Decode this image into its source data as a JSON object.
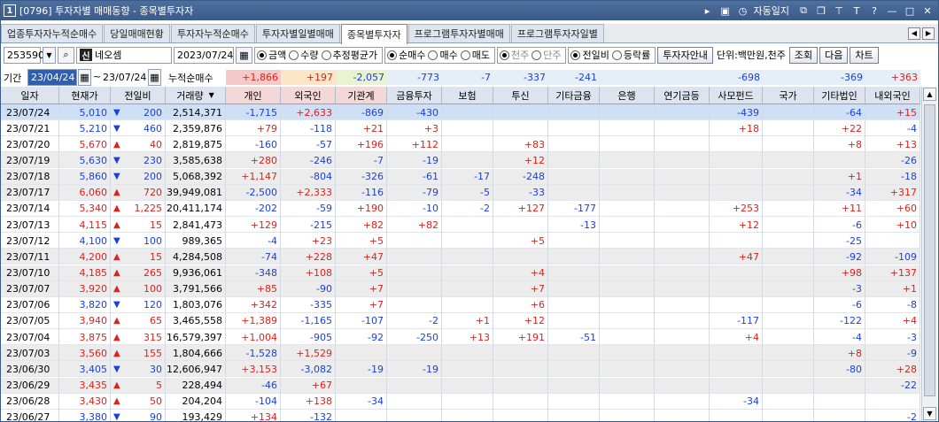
{
  "titlebar": {
    "num": "1",
    "code": "[0796]",
    "title": "투자자별 매매동향 - 종목별투자자",
    "auto_label": "자동일지",
    "help": "?"
  },
  "tabs": [
    "업종투자자누적순매수",
    "당일매매현황",
    "투자자누적순매수",
    "투자자별일별매매",
    "종목별투자자",
    "프로그램투자자별매매",
    "프로그램투자자일별"
  ],
  "active_tab": 4,
  "toolbar": {
    "code": "253590",
    "sin": "신",
    "name": "네오셈",
    "date": "2023/07/24",
    "g1": [
      {
        "label": "금액",
        "on": true
      },
      {
        "label": "수량",
        "on": false
      },
      {
        "label": "추정평균가",
        "on": false
      }
    ],
    "g2": [
      {
        "label": "순매수",
        "on": true
      },
      {
        "label": "매수",
        "on": false
      },
      {
        "label": "매도",
        "on": false
      }
    ],
    "g3": [
      {
        "label": "천주",
        "on": true
      },
      {
        "label": "단주",
        "on": false
      }
    ],
    "g4": [
      {
        "label": "전일비",
        "on": true
      },
      {
        "label": "등락률",
        "on": false
      }
    ],
    "investor_btn": "투자자안내",
    "unit": "단위:백만원,천주",
    "query": "조회",
    "next": "다음",
    "chart": "차트"
  },
  "period": {
    "label": "기간",
    "from": "23/04/24",
    "to": "23/07/24",
    "cum_label": "누적순매수",
    "sums": [
      "+1,866",
      "+197",
      "-2,057",
      "-773",
      "-7",
      "-337",
      "-241",
      "",
      "",
      "-698",
      "",
      "-369",
      "+363"
    ]
  },
  "headers": [
    "일자",
    "현재가",
    "전일비",
    "거래량",
    "개인",
    "외국인",
    "기관계",
    "금융투자",
    "보험",
    "투신",
    "기타금융",
    "은행",
    "연기금등",
    "사모펀드",
    "국가",
    "기타법인",
    "내외국인"
  ],
  "rows": [
    {
      "d": "23/07/24",
      "p": "5,010",
      "dir": "dn",
      "c": "200",
      "v": "2,514,371",
      "vals": [
        "-1,715",
        "+2,633",
        "-869",
        "-430",
        "",
        "",
        "",
        "",
        "",
        "-439",
        "",
        "-64",
        "+15"
      ]
    },
    {
      "d": "23/07/21",
      "p": "5,210",
      "dir": "dn",
      "c": "460",
      "v": "2,359,876",
      "vals": [
        "+79",
        "-118",
        "+21",
        "+3",
        "",
        "",
        "",
        "",
        "",
        "+18",
        "",
        "+22",
        "-4"
      ]
    },
    {
      "d": "23/07/20",
      "p": "5,670",
      "dir": "up",
      "c": "40",
      "v": "2,819,875",
      "vals": [
        "-160",
        "-57",
        "+196",
        "+112",
        "",
        "+83",
        "",
        "",
        "",
        "",
        "",
        "+8",
        "+13"
      ]
    },
    {
      "d": "23/07/19",
      "p": "5,630",
      "dir": "dn",
      "c": "230",
      "v": "3,585,638",
      "vals": [
        "+280",
        "-246",
        "-7",
        "-19",
        "",
        "+12",
        "",
        "",
        "",
        "",
        "",
        "",
        "-26"
      ]
    },
    {
      "d": "23/07/18",
      "p": "5,860",
      "dir": "dn",
      "c": "200",
      "v": "5,068,392",
      "vals": [
        "+1,147",
        "-804",
        "-326",
        "-61",
        "-17",
        "-248",
        "",
        "",
        "",
        "",
        "",
        "+1",
        "-18"
      ]
    },
    {
      "d": "23/07/17",
      "p": "6,060",
      "dir": "up",
      "c": "720",
      "v": "39,949,081",
      "vals": [
        "-2,500",
        "+2,333",
        "-116",
        "-79",
        "-5",
        "-33",
        "",
        "",
        "",
        "",
        "",
        "-34",
        "+317"
      ]
    },
    {
      "d": "23/07/14",
      "p": "5,340",
      "dir": "up",
      "c": "1,225",
      "v": "20,411,174",
      "vals": [
        "-202",
        "-59",
        "+190",
        "-10",
        "-2",
        "+127",
        "-177",
        "",
        "",
        "+253",
        "",
        "+11",
        "+60"
      ]
    },
    {
      "d": "23/07/13",
      "p": "4,115",
      "dir": "up",
      "c": "15",
      "v": "2,841,473",
      "vals": [
        "+129",
        "-215",
        "+82",
        "+82",
        "",
        "",
        "-13",
        "",
        "",
        "+12",
        "",
        "-6",
        "+10"
      ]
    },
    {
      "d": "23/07/12",
      "p": "4,100",
      "dir": "dn",
      "c": "100",
      "v": "989,365",
      "vals": [
        "-4",
        "+23",
        "+5",
        "",
        "",
        "+5",
        "",
        "",
        "",
        "",
        "",
        "-25",
        ""
      ]
    },
    {
      "d": "23/07/11",
      "p": "4,200",
      "dir": "up",
      "c": "15",
      "v": "4,284,508",
      "vals": [
        "-74",
        "+228",
        "+47",
        "",
        "",
        "",
        "",
        "",
        "",
        "+47",
        "",
        "-92",
        "-109"
      ]
    },
    {
      "d": "23/07/10",
      "p": "4,185",
      "dir": "up",
      "c": "265",
      "v": "9,936,061",
      "vals": [
        "-348",
        "+108",
        "+5",
        "",
        "",
        "+4",
        "",
        "",
        "",
        "",
        "",
        "+98",
        "+137"
      ]
    },
    {
      "d": "23/07/07",
      "p": "3,920",
      "dir": "up",
      "c": "100",
      "v": "3,791,566",
      "vals": [
        "+85",
        "-90",
        "+7",
        "",
        "",
        "+7",
        "",
        "",
        "",
        "",
        "",
        "-3",
        "+1"
      ]
    },
    {
      "d": "23/07/06",
      "p": "3,820",
      "dir": "dn",
      "c": "120",
      "v": "1,803,076",
      "vals": [
        "+342",
        "-335",
        "+7",
        "",
        "",
        "+6",
        "",
        "",
        "",
        "",
        "",
        "-6",
        "-8"
      ]
    },
    {
      "d": "23/07/05",
      "p": "3,940",
      "dir": "up",
      "c": "65",
      "v": "3,465,558",
      "vals": [
        "+1,389",
        "-1,165",
        "-107",
        "-2",
        "+1",
        "+12",
        "",
        "",
        "",
        "-117",
        "",
        "-122",
        "+4"
      ]
    },
    {
      "d": "23/07/04",
      "p": "3,875",
      "dir": "up",
      "c": "315",
      "v": "16,579,397",
      "vals": [
        "+1,004",
        "-905",
        "-92",
        "-250",
        "+13",
        "+191",
        "-51",
        "",
        "",
        "+4",
        "",
        "-4",
        "-3"
      ]
    },
    {
      "d": "23/07/03",
      "p": "3,560",
      "dir": "up",
      "c": "155",
      "v": "1,804,666",
      "vals": [
        "-1,528",
        "+1,529",
        "",
        "",
        "",
        "",
        "",
        "",
        "",
        "",
        "",
        "+8",
        "-9"
      ]
    },
    {
      "d": "23/06/30",
      "p": "3,405",
      "dir": "dn",
      "c": "30",
      "v": "12,606,947",
      "vals": [
        "+3,153",
        "-3,082",
        "-19",
        "-19",
        "",
        "",
        "",
        "",
        "",
        "",
        "",
        "-80",
        "+28"
      ]
    },
    {
      "d": "23/06/29",
      "p": "3,435",
      "dir": "up",
      "c": "5",
      "v": "228,494",
      "vals": [
        "-46",
        "+67",
        "",
        "",
        "",
        "",
        "",
        "",
        "",
        "",
        "",
        "",
        "-22"
      ]
    },
    {
      "d": "23/06/28",
      "p": "3,430",
      "dir": "up",
      "c": "50",
      "v": "204,204",
      "vals": [
        "-104",
        "+138",
        "-34",
        "",
        "",
        "",
        "",
        "",
        "",
        "-34",
        "",
        "",
        ""
      ]
    },
    {
      "d": "23/06/27",
      "p": "3,380",
      "dir": "dn",
      "c": "90",
      "v": "193,429",
      "vals": [
        "+134",
        "-132",
        "",
        "",
        "",
        "",
        "",
        "",
        "",
        "",
        "",
        "",
        "-2"
      ]
    }
  ]
}
